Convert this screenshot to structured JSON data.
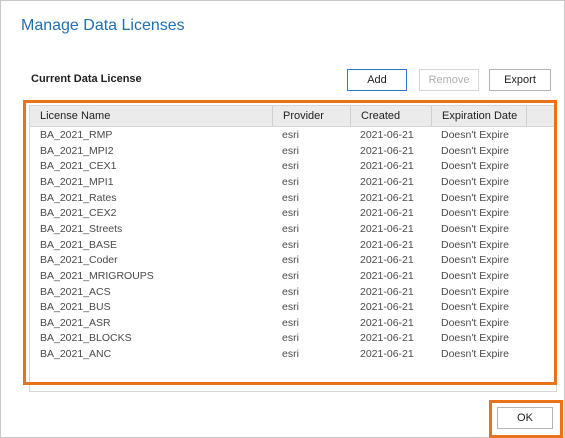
{
  "dialog": {
    "title": "Manage Data Licenses",
    "section_label": "Current Data License",
    "buttons": {
      "add": "Add",
      "remove": "Remove",
      "export": "Export",
      "ok": "OK"
    }
  },
  "table": {
    "columns": [
      "License Name",
      "Provider",
      "Created",
      "Expiration Date"
    ],
    "rows": [
      [
        "BA_2021_RMP",
        "esri",
        "2021-06-21",
        "Doesn't Expire"
      ],
      [
        "BA_2021_MPI2",
        "esri",
        "2021-06-21",
        "Doesn't Expire"
      ],
      [
        "BA_2021_CEX1",
        "esri",
        "2021-06-21",
        "Doesn't Expire"
      ],
      [
        "BA_2021_MPI1",
        "esri",
        "2021-06-21",
        "Doesn't Expire"
      ],
      [
        "BA_2021_Rates",
        "esri",
        "2021-06-21",
        "Doesn't Expire"
      ],
      [
        "BA_2021_CEX2",
        "esri",
        "2021-06-21",
        "Doesn't Expire"
      ],
      [
        "BA_2021_Streets",
        "esri",
        "2021-06-21",
        "Doesn't Expire"
      ],
      [
        "BA_2021_BASE",
        "esri",
        "2021-06-21",
        "Doesn't Expire"
      ],
      [
        "BA_2021_Coder",
        "esri",
        "2021-06-21",
        "Doesn't Expire"
      ],
      [
        "BA_2021_MRIGROUPS",
        "esri",
        "2021-06-21",
        "Doesn't Expire"
      ],
      [
        "BA_2021_ACS",
        "esri",
        "2021-06-21",
        "Doesn't Expire"
      ],
      [
        "BA_2021_BUS",
        "esri",
        "2021-06-21",
        "Doesn't Expire"
      ],
      [
        "BA_2021_ASR",
        "esri",
        "2021-06-21",
        "Doesn't Expire"
      ],
      [
        "BA_2021_BLOCKS",
        "esri",
        "2021-06-21",
        "Doesn't Expire"
      ],
      [
        "BA_2021_ANC",
        "esri",
        "2021-06-21",
        "Doesn't Expire"
      ]
    ]
  },
  "colors": {
    "title": "#1f6fb5",
    "highlight": "#e8731a",
    "primary_border": "#2a79c9"
  }
}
